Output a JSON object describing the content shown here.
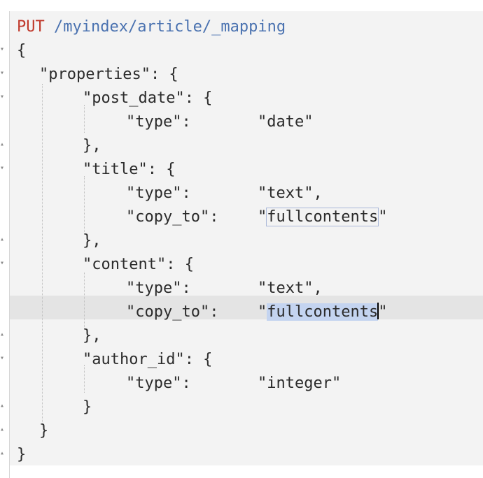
{
  "request": {
    "method": "PUT",
    "path": "/myindex/article/_mapping"
  },
  "lines": {
    "l2": "{",
    "l3": "\"properties\": {",
    "l4": "\"post_date\": {",
    "l5_key": "\"type\":",
    "l5_val": "\"date\"",
    "l6": "},",
    "l7": "\"title\": {",
    "l8_key": "\"type\":",
    "l8_val": "\"text\",",
    "l9_key": "\"copy_to\":",
    "l9_q1": "\"",
    "l9_val": "fullcontents",
    "l9_q2": "\"",
    "l10": "},",
    "l11": "\"content\": {",
    "l12_key": "\"type\":",
    "l12_val": "\"text\",",
    "l13_key": "\"copy_to\":",
    "l13_q1": "\"",
    "l13_val": "fullcontents",
    "l13_q2": "\"",
    "l14": "},",
    "l15": "\"author_id\": {",
    "l16_key": "\"type\":",
    "l16_val": "\"integer\"",
    "l17": "}",
    "l18": "}",
    "l19": "}"
  },
  "colors": {
    "method": "#c0392b",
    "path": "#4a72b0",
    "text": "#2b2b2b",
    "selection": "#c4d4f0"
  },
  "icons": {
    "fold_open": "caret-down-icon",
    "fold_end": "caret-end-icon"
  }
}
